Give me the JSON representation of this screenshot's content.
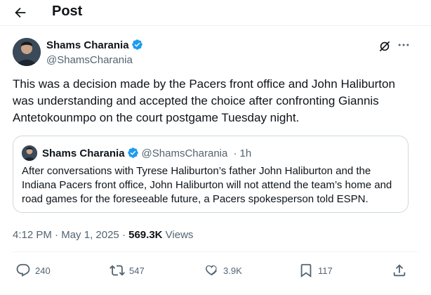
{
  "header": {
    "title": "Post"
  },
  "post": {
    "author_name": "Shams Charania",
    "author_handle": "@ShamsCharania",
    "text": "This was a decision made by the Pacers front office and John Haliburton was understanding and accepted the choice after confronting Giannis Antetokounmpo on the court postgame Tuesday night."
  },
  "quote": {
    "author_name": "Shams Charania",
    "author_handle": "@ShamsCharania",
    "separator": "·",
    "time": "1h",
    "text": "After conversations with Tyrese Haliburton’s father John Haliburton and the Indiana Pacers front office, John Haliburton will not attend the team’s home and road games for the foreseeable future, a Pacers spokesperson told ESPN."
  },
  "meta": {
    "time": "4:12 PM",
    "separator": "·",
    "date": "May 1, 2025",
    "views_count": "569.3K",
    "views_label": "Views"
  },
  "actions": {
    "replies": "240",
    "reposts": "547",
    "likes": "3.9K",
    "bookmarks": "117"
  },
  "colors": {
    "verified": "#1d9bf0",
    "muted": "#536471",
    "text": "#0f1419"
  },
  "icons": [
    "back-arrow-icon",
    "verified-badge-icon",
    "grok-icon",
    "more-icon",
    "reply-icon",
    "repost-icon",
    "like-icon",
    "bookmark-icon",
    "share-icon"
  ]
}
